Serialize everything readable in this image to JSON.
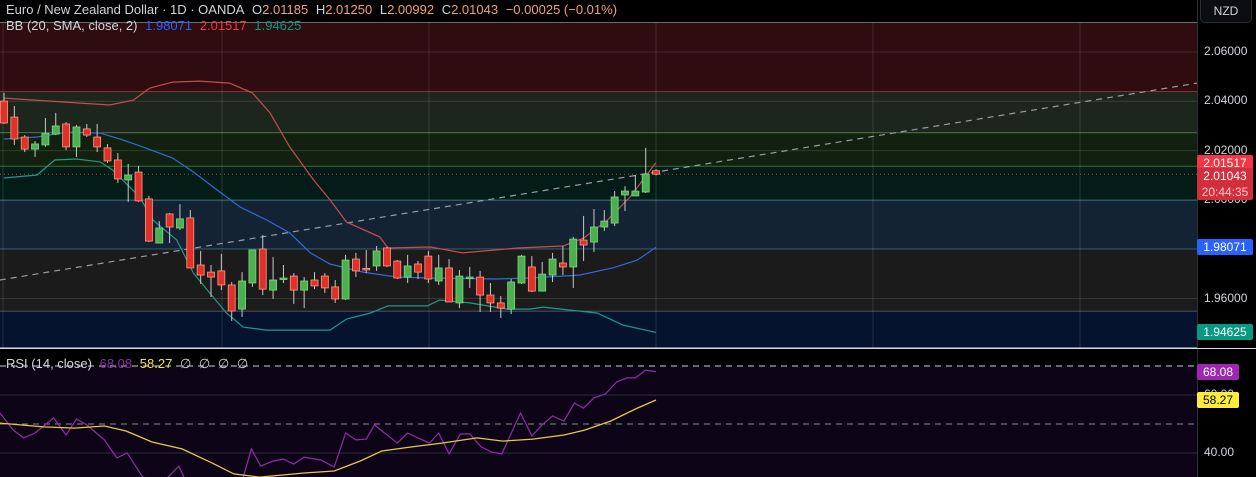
{
  "header": {
    "title": "Euro / New Zealand Dollar · 1D · OANDA",
    "open_label": "O",
    "open": "2.01185",
    "high_label": "H",
    "high": "2.01250",
    "low_label": "L",
    "low": "2.00992",
    "close_label": "C",
    "close": "2.01043",
    "change": "−0.00025 (−0.01%)"
  },
  "bb_legend": {
    "label": "BB (20, SMA, close, 2)",
    "basis": "1.98071",
    "upper": "2.01517",
    "lower": "1.94625"
  },
  "rsi_legend": {
    "label": "RSI (14, close)",
    "rsi": "68.08",
    "ma": "58.27",
    "na": [
      "∅",
      "∅",
      "∅",
      "∅"
    ]
  },
  "currency_button": "NZD",
  "price_axis": {
    "ticks": [
      {
        "v": 2.06,
        "t": "2.06000"
      },
      {
        "v": 2.04,
        "t": "2.04000"
      },
      {
        "v": 2.02,
        "t": "2.02000"
      },
      {
        "v": 2.0,
        "t": "2.00000"
      },
      {
        "v": 1.96,
        "t": "1.96000"
      }
    ],
    "labels": {
      "upper": {
        "v": 2.01517,
        "t": "2.01517",
        "color": "#f23645"
      },
      "last": {
        "v": 2.01043,
        "t": "2.01043",
        "countdown": "20:44:35",
        "color": "#d12f3c"
      },
      "basis": {
        "v": 1.98071,
        "t": "1.98071",
        "color": "#2962ff"
      },
      "lower": {
        "v": 1.94625,
        "t": "1.94625",
        "color": "#089981"
      }
    }
  },
  "rsi_axis": {
    "ticks": [
      {
        "v": 60,
        "t": "60.00"
      },
      {
        "v": 40,
        "t": "40.00"
      }
    ],
    "labels": {
      "rsi": {
        "v": 68.08,
        "t": "68.08",
        "color": "#9c27b0"
      },
      "ma": {
        "v": 58.27,
        "t": "58.27",
        "color": "#ffeb3b"
      }
    }
  },
  "colors": {
    "up": "#4caf50",
    "down": "#e0302a",
    "wick": "#c8c8c8",
    "bb_upper": "#c84b4f",
    "bb_basis": "#2f6bd8",
    "bb_lower": "#1f9a88",
    "rsi": "#8e2fa8",
    "rsi_ma": "#e8c840"
  },
  "chart_data": {
    "type": "candlestick",
    "title": "Euro / New Zealand Dollar · 1D · OANDA",
    "ylim": [
      1.9337,
      2.0718
    ],
    "candles_ohlc": [
      [
        2.0401,
        2.0434,
        2.0308,
        2.0312
      ],
      [
        2.0336,
        2.0381,
        2.0223,
        2.0247
      ],
      [
        2.0255,
        2.0263,
        2.0194,
        2.0206
      ],
      [
        2.0206,
        2.0239,
        2.0174,
        2.0227
      ],
      [
        2.0223,
        2.0332,
        2.0215,
        2.0271
      ],
      [
        2.0267,
        2.0353,
        2.0263,
        2.03
      ],
      [
        2.0308,
        2.0316,
        2.0202,
        2.0215
      ],
      [
        2.0215,
        2.0304,
        2.0174,
        2.0296
      ],
      [
        2.0288,
        2.0308,
        2.0255,
        2.0263
      ],
      [
        2.0255,
        2.0308,
        2.0194,
        2.0215
      ],
      [
        2.0211,
        2.0227,
        2.015,
        2.0158
      ],
      [
        2.0162,
        2.019,
        2.0069,
        2.0085
      ],
      [
        2.0081,
        2.0146,
        1.9992,
        2.0101
      ],
      [
        2.0113,
        2.0138,
        1.9992,
        1.9996
      ],
      [
        2.0004,
        2.0016,
        1.9829,
        1.9833
      ],
      [
        1.9825,
        1.9914,
        1.9825,
        1.9886
      ],
      [
        1.9943,
        1.9947,
        1.9825,
        1.989
      ],
      [
        1.9886,
        1.9983,
        1.9878,
        1.9923
      ],
      [
        1.9927,
        1.9959,
        1.9724,
        1.9724
      ],
      [
        1.9736,
        1.9793,
        1.9659,
        1.9695
      ],
      [
        1.9707,
        1.9736,
        1.9606,
        1.9687
      ],
      [
        1.9712,
        1.9781,
        1.9634,
        1.9655
      ],
      [
        1.9655,
        1.9667,
        1.9509,
        1.9549
      ],
      [
        1.9557,
        1.9707,
        1.9525,
        1.9671
      ],
      [
        1.9663,
        1.9797,
        1.9647,
        1.9797
      ],
      [
        1.9801,
        1.9858,
        1.9614,
        1.9638
      ],
      [
        1.9634,
        1.9768,
        1.9598,
        1.9675
      ],
      [
        1.9681,
        1.9736,
        1.9663,
        1.9683
      ],
      [
        1.9691,
        1.9703,
        1.9578,
        1.9634
      ],
      [
        1.9634,
        1.9687,
        1.9561,
        1.9671
      ],
      [
        1.9675,
        1.9707,
        1.9638,
        1.9651
      ],
      [
        1.9691,
        1.9703,
        1.9622,
        1.9643
      ],
      [
        1.9647,
        1.9675,
        1.9582,
        1.9598
      ],
      [
        1.9598,
        1.9777,
        1.9594,
        1.9756
      ],
      [
        1.976,
        1.9785,
        1.9687,
        1.9712
      ],
      [
        1.9722,
        1.9797,
        1.9703,
        1.972
      ],
      [
        1.9732,
        1.9813,
        1.9712,
        1.9793
      ],
      [
        1.9805,
        1.9809,
        1.9728,
        1.9732
      ],
      [
        1.9752,
        1.9756,
        1.9679,
        1.9683
      ],
      [
        1.9687,
        1.9777,
        1.9663,
        1.9732
      ],
      [
        1.974,
        1.9752,
        1.9679,
        1.9707
      ],
      [
        1.9772,
        1.9793,
        1.9663,
        1.9679
      ],
      [
        1.9671,
        1.9777,
        1.9655,
        1.9724
      ],
      [
        1.9724,
        1.976,
        1.9586,
        1.9586
      ],
      [
        1.9582,
        1.9716,
        1.9561,
        1.9691
      ],
      [
        1.9685,
        1.9728,
        1.9643,
        1.9687
      ],
      [
        1.9687,
        1.9712,
        1.9545,
        1.9614
      ],
      [
        1.9614,
        1.9663,
        1.9545,
        1.9582
      ],
      [
        1.9582,
        1.961,
        1.9521,
        1.9561
      ],
      [
        1.9557,
        1.9679,
        1.9537,
        1.9667
      ],
      [
        1.9663,
        1.9777,
        1.9659,
        1.9772
      ],
      [
        1.9728,
        1.9772,
        1.9626,
        1.963
      ],
      [
        1.963,
        1.9748,
        1.963,
        1.9699
      ],
      [
        1.9695,
        1.9785,
        1.9667,
        1.976
      ],
      [
        1.9744,
        1.9813,
        1.9695,
        1.9728
      ],
      [
        1.9728,
        1.985,
        1.9643,
        1.9841
      ],
      [
        1.9837,
        1.9935,
        1.9752,
        1.9817
      ],
      [
        1.9829,
        1.9963,
        1.9789,
        1.989
      ],
      [
        1.989,
        1.9959,
        1.9874,
        1.9914
      ],
      [
        1.9906,
        2.0036,
        1.9894,
        2.0012
      ],
      [
        2.002,
        2.0056,
        1.9955,
        2.0036
      ],
      [
        2.0016,
        2.0101,
        2.0016,
        2.0036
      ],
      [
        2.0032,
        2.0211,
        2.0028,
        2.0105
      ],
      [
        2.01185,
        2.0125,
        2.00992,
        2.01043
      ]
    ],
    "bb_upper": [
      [
        1,
        2.0413
      ],
      [
        11.2,
        2.0385
      ],
      [
        13.5,
        2.0405
      ],
      [
        15.1,
        2.0454
      ],
      [
        17.3,
        2.0478
      ],
      [
        19.9,
        2.0482
      ],
      [
        22.8,
        2.0474
      ],
      [
        25,
        2.0434
      ],
      [
        26.7,
        2.0353
      ],
      [
        28.6,
        2.0215
      ],
      [
        30.9,
        2.0081
      ],
      [
        32.5,
        2.0
      ],
      [
        34.1,
        1.991
      ],
      [
        37.3,
        1.985
      ],
      [
        38.1,
        1.9805
      ],
      [
        42.2,
        1.9809
      ],
      [
        45.3,
        1.9785
      ],
      [
        50.6,
        1.9805
      ],
      [
        55,
        1.9813
      ],
      [
        57,
        1.9845
      ],
      [
        59.3,
        1.9918
      ],
      [
        61.5,
        2.0012
      ],
      [
        64,
        2.01517
      ]
    ],
    "bb_basis": [
      [
        1,
        2.0247
      ],
      [
        4.2,
        2.0255
      ],
      [
        7.1,
        2.0275
      ],
      [
        10.3,
        2.0271
      ],
      [
        12.5,
        2.0243
      ],
      [
        14.4,
        2.0215
      ],
      [
        17.3,
        2.017
      ],
      [
        19.3,
        2.0113
      ],
      [
        21.6,
        2.004
      ],
      [
        23.8,
        1.9971
      ],
      [
        26.4,
        1.9918
      ],
      [
        28.6,
        1.9866
      ],
      [
        30.6,
        1.9785
      ],
      [
        32.5,
        1.974
      ],
      [
        35.7,
        1.9707
      ],
      [
        39,
        1.9687
      ],
      [
        42.2,
        1.9683
      ],
      [
        48.6,
        1.9679
      ],
      [
        51.8,
        1.9683
      ],
      [
        56.6,
        1.9695
      ],
      [
        59.8,
        1.9724
      ],
      [
        62.2,
        1.9756
      ],
      [
        64,
        1.98071
      ]
    ],
    "bb_lower": [
      [
        1,
        2.0089
      ],
      [
        4.2,
        2.0101
      ],
      [
        5.9,
        2.0162
      ],
      [
        8,
        2.0166
      ],
      [
        10.3,
        2.0154
      ],
      [
        11.5,
        2.0121
      ],
      [
        14.1,
        2.0012
      ],
      [
        15.4,
        1.9918
      ],
      [
        17.7,
        1.9837
      ],
      [
        19.3,
        1.9703
      ],
      [
        21.2,
        1.9606
      ],
      [
        22.5,
        1.9541
      ],
      [
        24.1,
        1.9484
      ],
      [
        26.4,
        1.9472
      ],
      [
        32.5,
        1.9472
      ],
      [
        34.1,
        1.9517
      ],
      [
        36.4,
        1.9541
      ],
      [
        38.1,
        1.957
      ],
      [
        41.9,
        1.957
      ],
      [
        43.1,
        1.9594
      ],
      [
        46,
        1.9582
      ],
      [
        49.6,
        1.9557
      ],
      [
        51.8,
        1.9557
      ],
      [
        53.1,
        1.9565
      ],
      [
        55.7,
        1.9553
      ],
      [
        58.3,
        1.9541
      ],
      [
        60.8,
        1.9492
      ],
      [
        64,
        1.94625
      ]
    ],
    "levels": [
      {
        "from": 2.0718,
        "to": 2.0438,
        "fill": "#2e0c10",
        "line": "#d9474b"
      },
      {
        "from": 2.0438,
        "to": 2.0271,
        "fill": "#1d261c",
        "line": "#8bd17c"
      },
      {
        "from": 2.0271,
        "to": 2.0136,
        "fill": "#11200f",
        "line": "#5cc060"
      },
      {
        "from": 2.0136,
        "to": 1.9998,
        "fill": "#041c18",
        "line": "#26a69a"
      },
      {
        "from": 1.9998,
        "to": 1.98,
        "fill": "#132333",
        "line": "#5ba7e0"
      },
      {
        "from": 1.98,
        "to": 1.9548,
        "fill": "#1b1b1c",
        "line": "#9a9ca3"
      },
      {
        "from": 1.9548,
        "to": 1.9337,
        "fill": "#06132e",
        "line": "#d9dce3"
      }
    ],
    "trendline": [
      [
        0.6,
        1.9675
      ],
      [
        116.3,
        2.0474
      ]
    ],
    "rsi": {
      "ylim": [
        27,
        78
      ],
      "upper_band": 70,
      "middle_band": 50,
      "rsi": [
        [
          0.6,
          53.8
        ],
        [
          1.9,
          47.9
        ],
        [
          2.9,
          45.2
        ],
        [
          4,
          46.9
        ],
        [
          5.8,
          52.1
        ],
        [
          7,
          46.2
        ],
        [
          8,
          51.7
        ],
        [
          9,
          49.7
        ],
        [
          10.7,
          44.5
        ],
        [
          11.9,
          38.3
        ],
        [
          12.9,
          40
        ],
        [
          14.4,
          31.7
        ],
        [
          15.9,
          30.5
        ],
        [
          16.7,
          31.2
        ],
        [
          17.9,
          35.5
        ],
        [
          18.6,
          30
        ],
        [
          20,
          27.5
        ],
        [
          22,
          27
        ],
        [
          23.9,
          29
        ],
        [
          24.9,
          41.4
        ],
        [
          25.8,
          35.5
        ],
        [
          27,
          37.2
        ],
        [
          28,
          37.9
        ],
        [
          29,
          36.2
        ],
        [
          30,
          38.6
        ],
        [
          31.6,
          37.6
        ],
        [
          32.9,
          35.2
        ],
        [
          34,
          46.9
        ],
        [
          35,
          44.5
        ],
        [
          36,
          44.8
        ],
        [
          36.8,
          49.7
        ],
        [
          39,
          43.4
        ],
        [
          40,
          46.9
        ],
        [
          41,
          45.2
        ],
        [
          42.1,
          43.4
        ],
        [
          43,
          46.9
        ],
        [
          44,
          39.7
        ],
        [
          45.1,
          46.6
        ],
        [
          46,
          46.6
        ],
        [
          47.1,
          42.1
        ],
        [
          48.1,
          40.3
        ],
        [
          49.1,
          39.7
        ],
        [
          50.9,
          53.8
        ],
        [
          52,
          45.9
        ],
        [
          53,
          49.7
        ],
        [
          54,
          52.8
        ],
        [
          55.1,
          51
        ],
        [
          56.1,
          57.2
        ],
        [
          57,
          55.5
        ],
        [
          58,
          59
        ],
        [
          59.1,
          60.3
        ],
        [
          60.2,
          64.5
        ],
        [
          61.2,
          65.9
        ],
        [
          62,
          65.9
        ],
        [
          63,
          68.6
        ],
        [
          64,
          68.08
        ]
      ],
      "rsi_ma": [
        [
          0.6,
          50.3
        ],
        [
          4.8,
          49
        ],
        [
          7.8,
          48.6
        ],
        [
          10.7,
          49.3
        ],
        [
          12.8,
          47.6
        ],
        [
          15.3,
          43.8
        ],
        [
          18.2,
          41.4
        ],
        [
          21.1,
          36.6
        ],
        [
          23.2,
          32.8
        ],
        [
          25.7,
          31.7
        ],
        [
          30,
          33.1
        ],
        [
          32.9,
          33.8
        ],
        [
          35.4,
          37.2
        ],
        [
          37.5,
          40.7
        ],
        [
          40.4,
          42.1
        ],
        [
          43.3,
          43.4
        ],
        [
          46.7,
          45.2
        ],
        [
          49.2,
          44.1
        ],
        [
          52.1,
          44.8
        ],
        [
          55.1,
          46.2
        ],
        [
          57.1,
          47.9
        ],
        [
          59.6,
          51
        ],
        [
          62.2,
          55.5
        ],
        [
          64,
          58.27
        ]
      ]
    }
  }
}
